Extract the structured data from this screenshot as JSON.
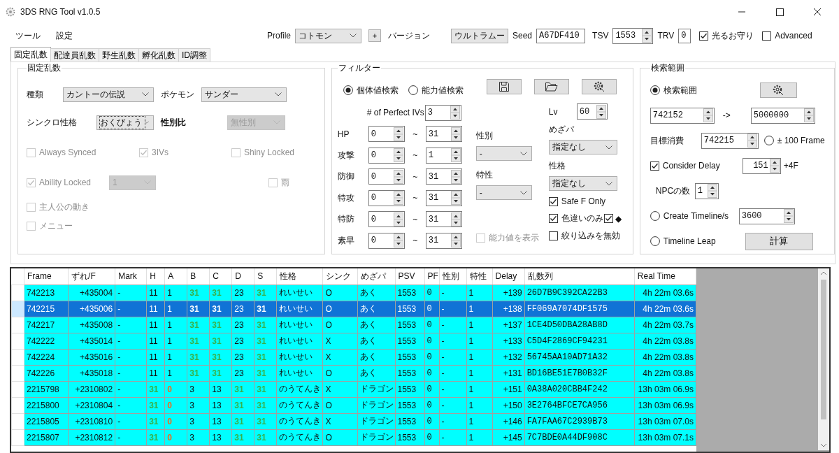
{
  "window": {
    "title": "3DS RNG Tool v1.0.5"
  },
  "menu": [
    "ツール",
    "設定"
  ],
  "toolbar": {
    "profile_label": "Profile",
    "profile": "コトモン",
    "add_button": "+",
    "version_label": "バージョン",
    "version": "ウルトラムー",
    "seed_label": "Seed",
    "seed": "A67DF410",
    "tsv_label": "TSV",
    "tsv": "1553",
    "trv_label": "TRV",
    "trv": "0",
    "checks": [
      {
        "label": "光るお守り",
        "checked": true
      },
      {
        "label": "Advanced",
        "checked": false
      }
    ]
  },
  "tabs": [
    {
      "label": "固定乱数",
      "selected": true
    },
    {
      "label": "配達員乱数",
      "selected": false
    },
    {
      "label": "野生乱数",
      "selected": false
    },
    {
      "label": "孵化乱数",
      "selected": false
    },
    {
      "label": "ID調整",
      "selected": false
    }
  ],
  "stationary": {
    "title": "固定乱数",
    "category_label": "種類",
    "category": "カントーの伝説",
    "pokemon_label": "ポケモン",
    "pokemon": "サンダー",
    "synchro_label": "シンクロ性格",
    "synchro": "おくびょう",
    "gender_ratio_label": "性別比",
    "gender_ratio": "無性別",
    "ability_slot": "1",
    "options": [
      {
        "label": "Always Synced",
        "checked": false,
        "disabled": true
      },
      {
        "label": "3IVs",
        "checked": true,
        "disabled": true
      },
      {
        "label": "Shiny Locked",
        "checked": false,
        "disabled": true
      },
      {
        "label": "Ability Locked",
        "checked": true,
        "disabled": true
      },
      {
        "label": "雨",
        "checked": false,
        "disabled": true
      },
      {
        "label": "主人公の動き",
        "checked": false,
        "disabled": true
      },
      {
        "label": "メニュー",
        "checked": false,
        "disabled": true
      }
    ]
  },
  "filter": {
    "title": "フィルター",
    "modes": [
      {
        "label": "個体値検索",
        "selected": true
      },
      {
        "label": "能力値検索",
        "selected": false
      }
    ],
    "tool_buttons": [
      {
        "kind": "save"
      },
      {
        "kind": "open"
      },
      {
        "kind": "settings"
      }
    ],
    "perfect_ivs_label": "# of Perfect IVs",
    "perfect_ivs": "3",
    "stats": [
      {
        "label": "HP",
        "min": "0",
        "sep": "~",
        "max": "31"
      },
      {
        "label": "攻撃",
        "min": "0",
        "sep": "~",
        "max": "1"
      },
      {
        "label": "防御",
        "min": "0",
        "sep": "~",
        "max": "31"
      },
      {
        "label": "特攻",
        "min": "0",
        "sep": "~",
        "max": "31"
      },
      {
        "label": "特防",
        "min": "0",
        "sep": "~",
        "max": "31"
      },
      {
        "label": "素早",
        "min": "0",
        "sep": "~",
        "max": "31"
      }
    ],
    "gender_label": "性別",
    "gender": "-",
    "ability_label": "特性",
    "ability": "-",
    "show_stats": {
      "label": "能力値を表示",
      "checked": false,
      "disabled": true
    },
    "level_label": "Lv",
    "level": "60",
    "hidden_power_label": "めざパ",
    "hidden_power": "指定なし",
    "nature_label": "性格",
    "nature": "指定なし",
    "safe_f": {
      "label": "Safe F Only",
      "checked": true
    },
    "shiny_only": {
      "label": "色違いのみ",
      "checked": true
    },
    "square": {
      "label": "◆",
      "checked": true
    },
    "disable_filter": {
      "label": "絞り込みを無効",
      "checked": false
    }
  },
  "range": {
    "title": "検索範囲",
    "range_radio": {
      "label": "検索範囲",
      "selected": true
    },
    "start": "742152",
    "arrow": "->",
    "end": "5000000",
    "target_label": "目標消費",
    "target": "742215",
    "frame_radio": {
      "label": "± 100 Frame",
      "selected": false
    },
    "delay_check": {
      "label": "Consider Delay",
      "checked": true
    },
    "delay": "151",
    "delay_suffix": "+4F",
    "npc_label": "NPCの数",
    "npc": "1",
    "timeline_radio": {
      "label": "Create Timeline/s",
      "selected": false
    },
    "timeline": "3600",
    "leap_radio": {
      "label": "Timeline Leap",
      "selected": false
    },
    "calc_button": "計算"
  },
  "table": {
    "columns": [
      "Frame",
      "ずれ/F",
      "Mark",
      "H",
      "A",
      "B",
      "C",
      "D",
      "S",
      "性格",
      "シンク",
      "めざパ",
      "PSV",
      "PF",
      "性別",
      "特性",
      "Delay",
      "乱数列",
      "Real Time"
    ],
    "rows": [
      {
        "selected": false,
        "frame": "742213",
        "shift": "+435004",
        "mark": "-",
        "ivs": [
          {
            "v": "11",
            "kind": "normal"
          },
          {
            "v": "1",
            "kind": "normal"
          },
          {
            "v": "31",
            "kind": "perfect"
          },
          {
            "v": "31",
            "kind": "perfect"
          },
          {
            "v": "23",
            "kind": "normal"
          },
          {
            "v": "31",
            "kind": "perfect"
          }
        ],
        "nature": "れいせい",
        "sync": "O",
        "hidden_power": "あく",
        "psv": "1553",
        "pf": "0",
        "gender": "-",
        "ability": "1",
        "delay": "+139",
        "rng": "26D7B9C392CA22B3",
        "time": "4h 22m 03.6s"
      },
      {
        "selected": true,
        "frame": "742215",
        "shift": "+435006",
        "mark": "-",
        "ivs": [
          {
            "v": "11",
            "kind": "normal"
          },
          {
            "v": "1",
            "kind": "normal"
          },
          {
            "v": "31",
            "kind": "perfect"
          },
          {
            "v": "31",
            "kind": "perfect"
          },
          {
            "v": "23",
            "kind": "normal"
          },
          {
            "v": "31",
            "kind": "perfect"
          }
        ],
        "nature": "れいせい",
        "sync": "O",
        "hidden_power": "あく",
        "psv": "1553",
        "pf": "0",
        "gender": "-",
        "ability": "1",
        "delay": "+138",
        "rng": "FF069A7074DF1575",
        "time": "4h 22m 03.6s"
      },
      {
        "selected": false,
        "frame": "742217",
        "shift": "+435008",
        "mark": "-",
        "ivs": [
          {
            "v": "11",
            "kind": "normal"
          },
          {
            "v": "1",
            "kind": "normal"
          },
          {
            "v": "31",
            "kind": "perfect"
          },
          {
            "v": "31",
            "kind": "perfect"
          },
          {
            "v": "23",
            "kind": "normal"
          },
          {
            "v": "31",
            "kind": "perfect"
          }
        ],
        "nature": "れいせい",
        "sync": "O",
        "hidden_power": "あく",
        "psv": "1553",
        "pf": "0",
        "gender": "-",
        "ability": "1",
        "delay": "+137",
        "rng": "1CE4D50DBA28AB8D",
        "time": "4h 22m 03.7s"
      },
      {
        "selected": false,
        "frame": "742222",
        "shift": "+435014",
        "mark": "-",
        "ivs": [
          {
            "v": "11",
            "kind": "normal"
          },
          {
            "v": "1",
            "kind": "normal"
          },
          {
            "v": "31",
            "kind": "perfect"
          },
          {
            "v": "31",
            "kind": "perfect"
          },
          {
            "v": "23",
            "kind": "normal"
          },
          {
            "v": "31",
            "kind": "perfect"
          }
        ],
        "nature": "れいせい",
        "sync": "X",
        "hidden_power": "あく",
        "psv": "1553",
        "pf": "0",
        "gender": "-",
        "ability": "1",
        "delay": "+133",
        "rng": "C5D4F2869CF94231",
        "time": "4h 22m 03.8s"
      },
      {
        "selected": false,
        "frame": "742224",
        "shift": "+435016",
        "mark": "-",
        "ivs": [
          {
            "v": "11",
            "kind": "normal"
          },
          {
            "v": "1",
            "kind": "normal"
          },
          {
            "v": "31",
            "kind": "perfect"
          },
          {
            "v": "31",
            "kind": "perfect"
          },
          {
            "v": "23",
            "kind": "normal"
          },
          {
            "v": "31",
            "kind": "perfect"
          }
        ],
        "nature": "れいせい",
        "sync": "X",
        "hidden_power": "あく",
        "psv": "1553",
        "pf": "0",
        "gender": "-",
        "ability": "1",
        "delay": "+132",
        "rng": "56745AA10AD71A32",
        "time": "4h 22m 03.8s"
      },
      {
        "selected": false,
        "frame": "742226",
        "shift": "+435018",
        "mark": "-",
        "ivs": [
          {
            "v": "11",
            "kind": "normal"
          },
          {
            "v": "1",
            "kind": "normal"
          },
          {
            "v": "31",
            "kind": "perfect"
          },
          {
            "v": "31",
            "kind": "perfect"
          },
          {
            "v": "23",
            "kind": "normal"
          },
          {
            "v": "31",
            "kind": "perfect"
          }
        ],
        "nature": "れいせい",
        "sync": "O",
        "hidden_power": "あく",
        "psv": "1553",
        "pf": "0",
        "gender": "-",
        "ability": "1",
        "delay": "+131",
        "rng": "BD16BE51E7B0B32F",
        "time": "4h 22m 03.8s"
      },
      {
        "selected": false,
        "frame": "2215798",
        "shift": "+2310802",
        "mark": "-",
        "ivs": [
          {
            "v": "31",
            "kind": "perfect"
          },
          {
            "v": "0",
            "kind": "zero"
          },
          {
            "v": "3",
            "kind": "normal"
          },
          {
            "v": "13",
            "kind": "normal"
          },
          {
            "v": "31",
            "kind": "perfect"
          },
          {
            "v": "31",
            "kind": "perfect"
          }
        ],
        "nature": "のうてんき",
        "sync": "X",
        "hidden_power": "ドラゴン",
        "psv": "1553",
        "pf": "0",
        "gender": "-",
        "ability": "1",
        "delay": "+151",
        "rng": "0A38A020CBB4F242",
        "time": "13h 03m 06.9s"
      },
      {
        "selected": false,
        "frame": "2215800",
        "shift": "+2310804",
        "mark": "-",
        "ivs": [
          {
            "v": "31",
            "kind": "perfect"
          },
          {
            "v": "0",
            "kind": "zero"
          },
          {
            "v": "3",
            "kind": "normal"
          },
          {
            "v": "13",
            "kind": "normal"
          },
          {
            "v": "31",
            "kind": "perfect"
          },
          {
            "v": "31",
            "kind": "perfect"
          }
        ],
        "nature": "のうてんき",
        "sync": "O",
        "hidden_power": "ドラゴン",
        "psv": "1553",
        "pf": "0",
        "gender": "-",
        "ability": "1",
        "delay": "+150",
        "rng": "3E2764BFCE7CA956",
        "time": "13h 03m 06.9s"
      },
      {
        "selected": false,
        "frame": "2215805",
        "shift": "+2310810",
        "mark": "-",
        "ivs": [
          {
            "v": "31",
            "kind": "perfect"
          },
          {
            "v": "0",
            "kind": "zero"
          },
          {
            "v": "3",
            "kind": "normal"
          },
          {
            "v": "13",
            "kind": "normal"
          },
          {
            "v": "31",
            "kind": "perfect"
          },
          {
            "v": "31",
            "kind": "perfect"
          }
        ],
        "nature": "のうてんき",
        "sync": "X",
        "hidden_power": "ドラゴン",
        "psv": "1553",
        "pf": "0",
        "gender": "-",
        "ability": "1",
        "delay": "+146",
        "rng": "FA7FAA67C2939B73",
        "time": "13h 03m 07.0s"
      },
      {
        "selected": false,
        "frame": "2215807",
        "shift": "+2310812",
        "mark": "-",
        "ivs": [
          {
            "v": "31",
            "kind": "perfect"
          },
          {
            "v": "0",
            "kind": "zero"
          },
          {
            "v": "3",
            "kind": "normal"
          },
          {
            "v": "13",
            "kind": "normal"
          },
          {
            "v": "31",
            "kind": "perfect"
          },
          {
            "v": "31",
            "kind": "perfect"
          }
        ],
        "nature": "のうてんき",
        "sync": "O",
        "hidden_power": "ドラゴン",
        "psv": "1553",
        "pf": "0",
        "gender": "-",
        "ability": "1",
        "delay": "+145",
        "rng": "7C7BDE0A44DF908C",
        "time": "13h 03m 07.1s"
      }
    ]
  }
}
